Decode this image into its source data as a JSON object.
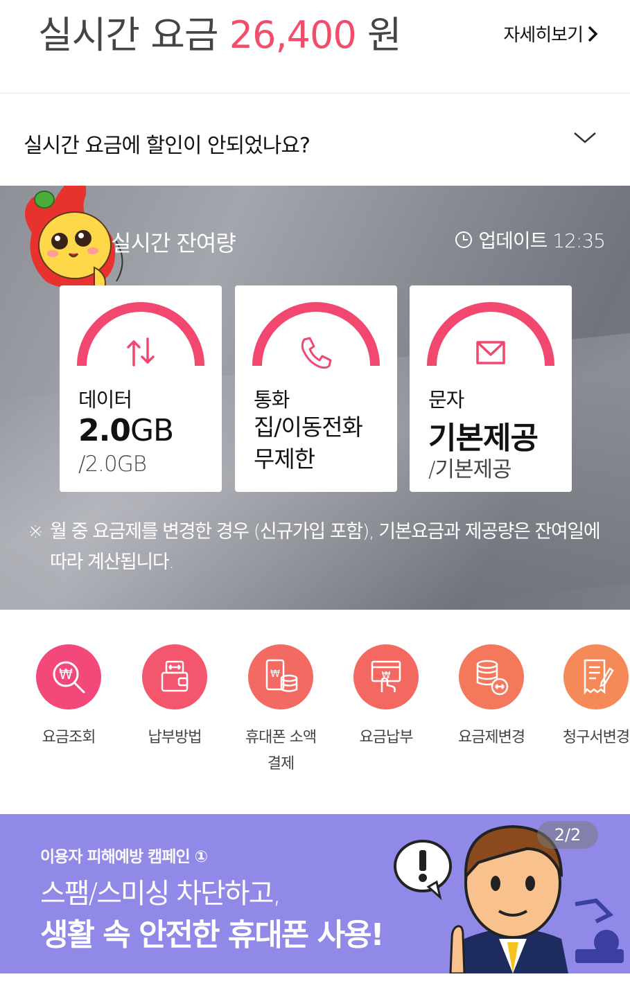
{
  "header": {
    "title_prefix": "실시간 요금",
    "amount": "26,400",
    "currency": "원",
    "detail_link": "자세히보기"
  },
  "discount_question": {
    "text": "실시간 요금에 할인이 안되었나요?"
  },
  "remaining": {
    "title": "실시간 잔여량",
    "update_label": "업데이트 12:35",
    "cards": [
      {
        "label": "데이터",
        "value_num": "2.0",
        "value_unit": "GB",
        "total": "/2.0GB",
        "icon": "data-arrows-icon"
      },
      {
        "label": "통화",
        "line1": "집/이동전화",
        "line2": "무제한",
        "icon": "phone-icon"
      },
      {
        "label": "문자",
        "value_text": "기본제공",
        "total": "/기본제공",
        "icon": "mail-icon"
      }
    ],
    "notice_mark": "※",
    "notice_line1": "월 중 요금제를 변경한 경우 (신규가입 포함), 기본요금과 제공량은 잔여일에",
    "notice_line2": "따라 계산됩니다."
  },
  "quick_menu": [
    {
      "label": "요금조회",
      "icon": "won-search-icon",
      "color": "#f2487a"
    },
    {
      "label": "납부방법",
      "icon": "wallet-icon",
      "color": "#f4566e"
    },
    {
      "label": "휴대폰 소액",
      "label2": "결제",
      "icon": "phone-coins-icon",
      "color": "#f36a63"
    },
    {
      "label": "요금납부",
      "icon": "pay-hand-icon",
      "color": "#f46862"
    },
    {
      "label": "요금제변경",
      "icon": "database-exchange-icon",
      "color": "#f3785c"
    },
    {
      "label": "청구서변경",
      "icon": "bill-edit-icon",
      "color": "#f58957"
    }
  ],
  "banner": {
    "subtitle": "이용자 피해예방 캠페인 ①",
    "line1": "스팸/스미싱 차단하고,",
    "line2": "생활 속 안전한 휴대폰 사용!",
    "pager": "2/2",
    "color": "#9089e8"
  },
  "colors": {
    "accent": "#f04e6a",
    "gauge": "#f2476f"
  }
}
